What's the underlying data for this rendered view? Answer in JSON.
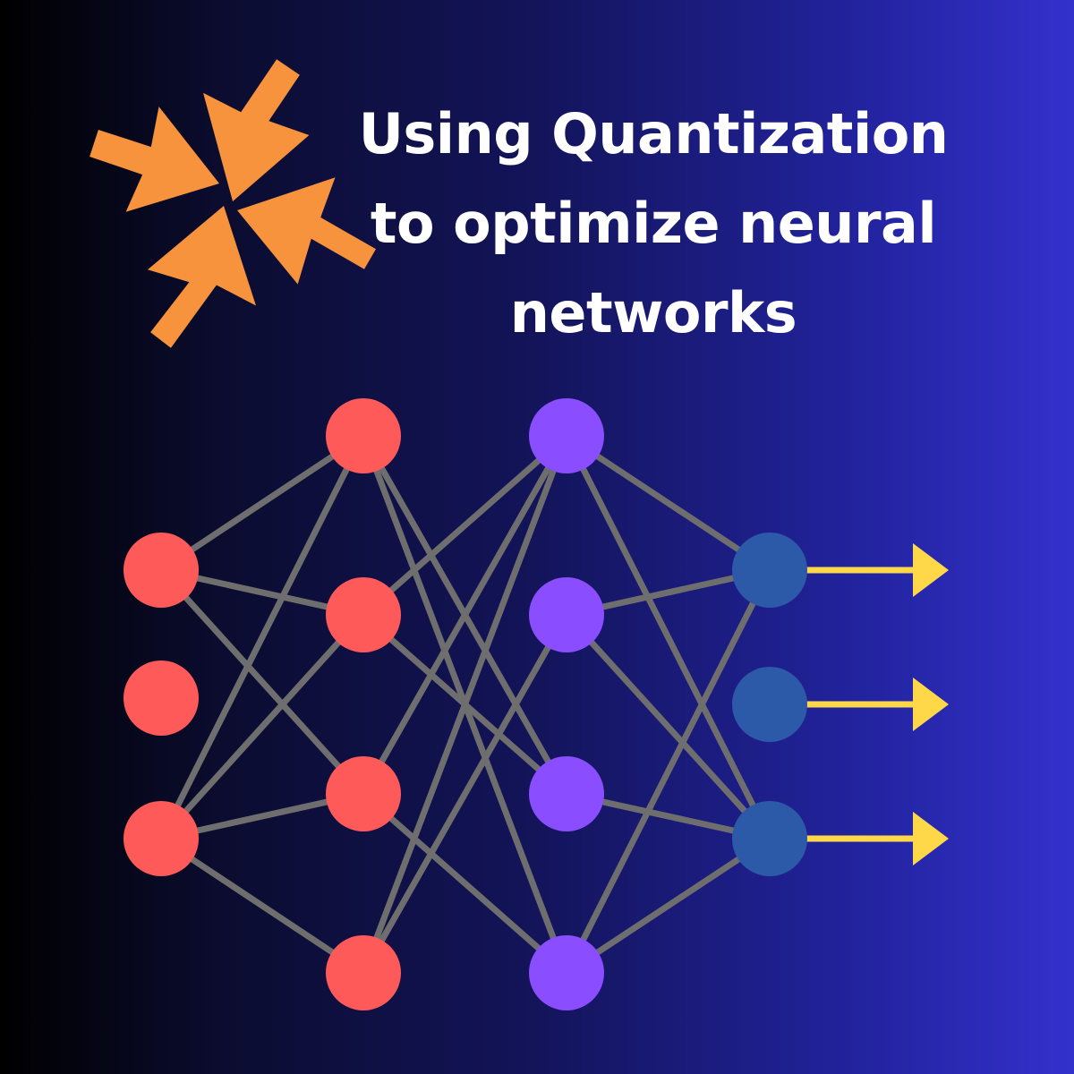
{
  "title": {
    "line1": "Using Quantization",
    "line2": "to optimize neural",
    "line3": "networks"
  },
  "icons": {
    "compress": "compress-arrows-icon",
    "output_arrow": "arrow-right-icon"
  },
  "colors": {
    "background_start": "#000000",
    "background_end": "#3331cc",
    "icon": "#f7923d",
    "input_node": "#ff5a5a",
    "hidden1_node": "#ff5a5a",
    "hidden2_node": "#8a4dff",
    "output_node": "#2c5aa8",
    "edge": "#6e6e6e",
    "output_arrow": "#ffd84a",
    "title": "#ffffff"
  },
  "network": {
    "layers": [
      {
        "name": "input",
        "node_count": 3
      },
      {
        "name": "hidden-1",
        "node_count": 4
      },
      {
        "name": "hidden-2",
        "node_count": 4
      },
      {
        "name": "output",
        "node_count": 3
      }
    ],
    "output_arrow_count": 3
  }
}
